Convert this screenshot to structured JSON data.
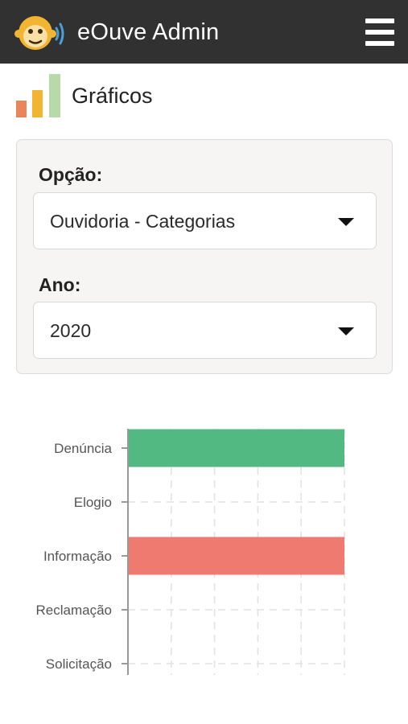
{
  "header": {
    "app_title": "eOuve Admin",
    "logo_icon": "monkey-face-sound-icon",
    "menu_icon": "hamburger-menu-icon",
    "background": "#313131"
  },
  "page": {
    "title": "Gráficos",
    "icon": "bar-chart-icon"
  },
  "filters": {
    "option_label": "Opção:",
    "option_value": "Ouvidoria - Categorias",
    "year_label": "Ano:",
    "year_value": "2020"
  },
  "chart_data": {
    "type": "bar",
    "orientation": "horizontal",
    "categories": [
      "Denúncia",
      "Elogio",
      "Informação",
      "Reclamação",
      "Solicitação"
    ],
    "values": [
      1,
      0,
      1,
      0,
      0
    ],
    "colors": [
      "#52b982",
      "#cccccc",
      "#ee7a70",
      "#cccccc",
      "#cccccc"
    ],
    "xlim": [
      0,
      1
    ],
    "grid": true,
    "legend": "none"
  }
}
